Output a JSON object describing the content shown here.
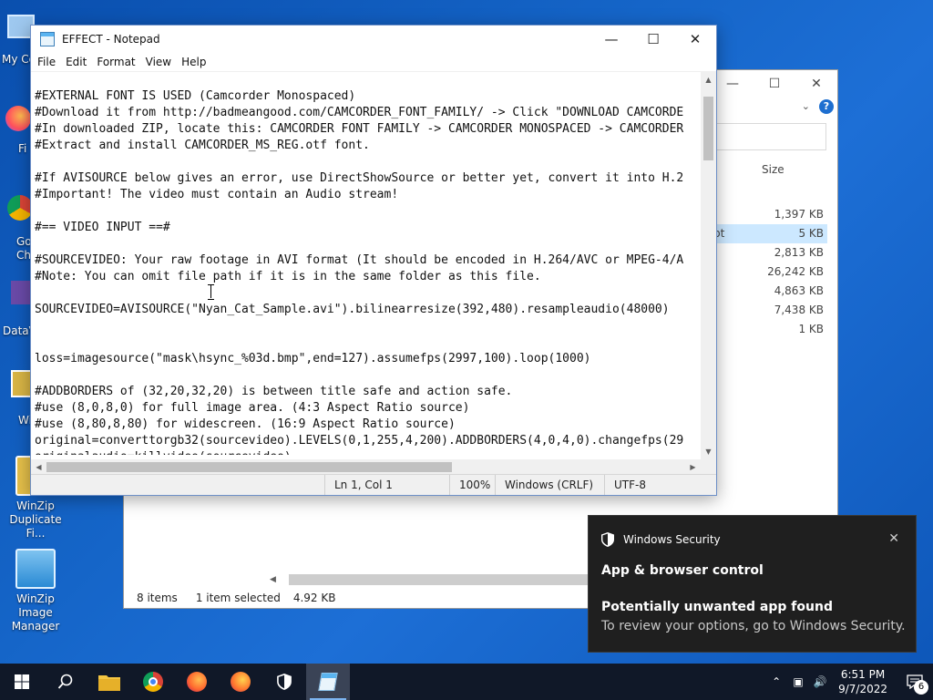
{
  "desktop": {
    "icons": [
      {
        "label": "My Co"
      },
      {
        "label": "Fi"
      },
      {
        "label": "Go Ch"
      },
      {
        "label": "DataV"
      },
      {
        "label": "Wi"
      },
      {
        "label": "WinZip Duplicate Fi..."
      },
      {
        "label": "WinZip Image Manager"
      }
    ]
  },
  "explorer": {
    "size_header": "Size",
    "sizes": [
      "1,397 KB",
      "5 KB",
      "2,813 KB",
      "26,242 KB",
      "4,863 KB",
      "7,438 KB",
      "1 KB"
    ],
    "selected_row_prefix": "pt",
    "status": {
      "items": "8 items",
      "selected": "1 item selected",
      "size": "4.92 KB"
    }
  },
  "notepad": {
    "title": "EFFECT - Notepad",
    "menu": [
      "File",
      "Edit",
      "Format",
      "View",
      "Help"
    ],
    "lines": [
      "#EXTERNAL FONT IS USED (Camcorder Monospaced)",
      "#Download it from http://badmeangood.com/CAMCORDER_FONT_FAMILY/ -> Click \"DOWNLOAD CAMCORDE",
      "#In downloaded ZIP, locate this: CAMCORDER FONT FAMILY -> CAMCORDER MONOSPACED -> CAMCORDER",
      "#Extract and install CAMCORDER_MS_REG.otf font.",
      "",
      "#If AVISOURCE below gives an error, use DirectShowSource or better yet, convert it into H.2",
      "#Important! The video must contain an Audio stream!",
      "",
      "#== VIDEO INPUT ==#",
      "",
      "#SOURCEVIDEO: Your raw footage in AVI format (It should be encoded in H.264/AVC or MPEG-4/A",
      "#Note: You can omit file path if it is in the same folder as this file.",
      "",
      "SOURCEVIDEO=AVISOURCE(\"Nyan_Cat_Sample.avi\").bilinearresize(392,480).resampleaudio(48000)",
      "",
      "",
      "loss=imagesource(\"mask\\hsync_%03d.bmp\",end=127).assumefps(2997,100).loop(1000)",
      "",
      "#ADDBORDERS of (32,20,32,20) is between title safe and action safe.",
      "#use (8,0,8,0) for full image area. (4:3 Aspect Ratio source)",
      "#use (8,80,8,80) for widescreen. (16:9 Aspect Ratio source)",
      "original=converttorgb32(sourcevideo).LEVELS(0,1,255,4,200).ADDBORDERS(4,0,4,0).changefps(29",
      "originalaudio=killvideo(sourcevideo)"
    ],
    "status": {
      "position": "Ln 1, Col 1",
      "zoom": "100%",
      "line_ending": "Windows (CRLF)",
      "encoding": "UTF-8"
    }
  },
  "toast": {
    "app": "Windows Security",
    "heading": "App & browser control",
    "title": "Potentially unwanted app found",
    "body": "To review your options, go to Windows Security."
  },
  "taskbar": {
    "time": "6:51 PM",
    "date": "9/7/2022",
    "notification_count": "6"
  }
}
